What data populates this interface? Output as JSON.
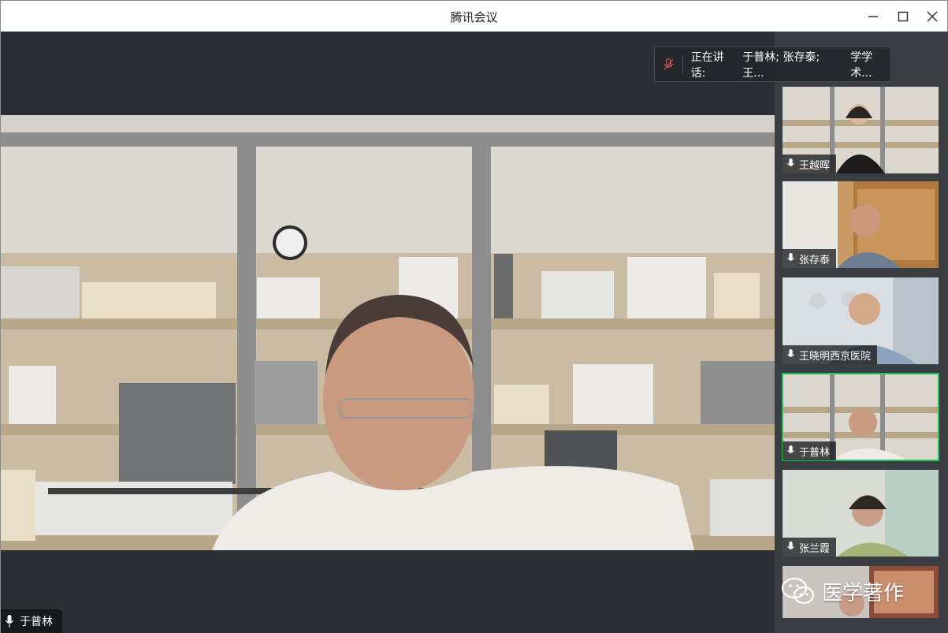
{
  "window": {
    "title": "腾讯会议"
  },
  "speaking": {
    "label": "正在讲话:",
    "names": "于普林; 张存泰; 王...",
    "overflow_text": "学学术..."
  },
  "main": {
    "speaker_name": "于普林"
  },
  "participants": [
    {
      "name": "王越晖",
      "active": false
    },
    {
      "name": "张存泰",
      "active": false
    },
    {
      "name": "王晓明西京医院",
      "active": false
    },
    {
      "name": "于普林",
      "active": true
    },
    {
      "name": "张兰霞",
      "active": false
    }
  ],
  "watermark": {
    "text": "医学著作",
    "icon": "wechat-icon"
  },
  "colors": {
    "active_border": "#23c25e",
    "background": "#2b2e33"
  }
}
